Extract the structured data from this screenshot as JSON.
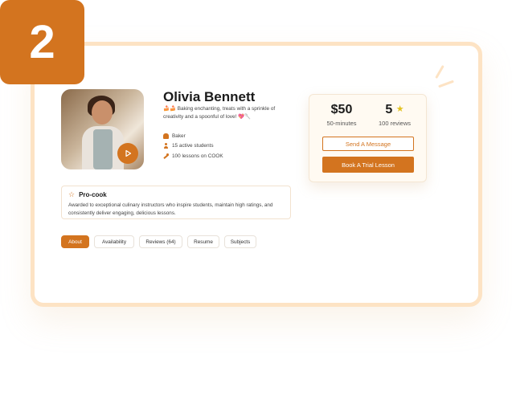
{
  "step": {
    "number": "2"
  },
  "profile": {
    "name": "Olivia Bennett",
    "bio": "🍰🍰 Baking enchanting, treats with a sprinkle of creativity and a spoonful of love! 💖🥄",
    "meta": [
      {
        "icon": "chef-hat-icon",
        "text": "Baker"
      },
      {
        "icon": "user-icon",
        "text": "15 active students"
      },
      {
        "icon": "spoon-icon",
        "text": "100 lessons on COOK"
      }
    ]
  },
  "pricing": {
    "price": "$50",
    "duration": "50-minutes",
    "rating": "5",
    "reviews": "100 reviews",
    "send_message_label": "Send A Message",
    "book_trial_label": "Book A Trial Lesson"
  },
  "award": {
    "title": "Pro-cook",
    "description": "Awarded to exceptional culinary instructors who inspire students, maintain high ratings, and consistently deliver engaging, delicious lessons."
  },
  "tabs": [
    {
      "label": "About",
      "active": true
    },
    {
      "label": "Availability",
      "active": false
    },
    {
      "label": "Reviews (64)",
      "active": false
    },
    {
      "label": "Resume",
      "active": false
    },
    {
      "label": "Subjects",
      "active": false
    }
  ],
  "colors": {
    "accent": "#d3741f",
    "frame_border": "#fde3c4",
    "star": "#e2c21f"
  }
}
